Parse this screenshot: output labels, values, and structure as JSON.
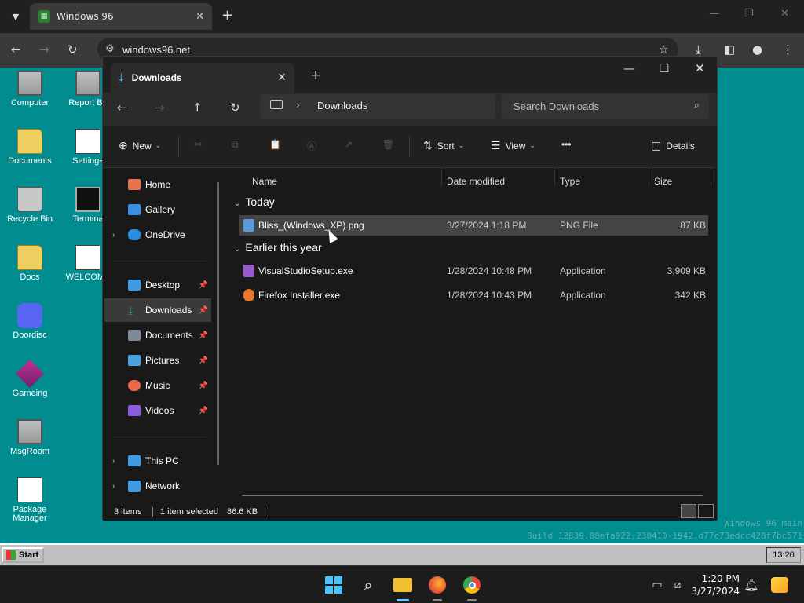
{
  "browser": {
    "tab_title": "Windows 96",
    "url": "windows96.net",
    "favicon": "windows96-favicon"
  },
  "desktop": {
    "icons": [
      {
        "label": "Computer",
        "icon": "computer-icon"
      },
      {
        "label": "Report Bu",
        "icon": "report-icon"
      },
      {
        "label": "Documents",
        "icon": "folder-icon"
      },
      {
        "label": "Settings",
        "icon": "settings-icon"
      },
      {
        "label": "Recycle Bin",
        "icon": "recycle-bin-icon"
      },
      {
        "label": "Termina",
        "icon": "terminal-icon"
      },
      {
        "label": "Docs",
        "icon": "folder-icon"
      },
      {
        "label": "WELCOME",
        "icon": "markdown-file-icon"
      },
      {
        "label": "Doordisc",
        "icon": "discord-icon"
      },
      {
        "label": "Gameing",
        "icon": "cube-icon"
      },
      {
        "label": "MsgRoom",
        "icon": "msgroom-icon"
      },
      {
        "label": "Package Manager",
        "icon": "package-icon"
      }
    ],
    "watermark_line1": "Windows 96 main",
    "watermark_line2": "Build 12839.88efa922.230410-1942.d77c73edcc428f7bc571",
    "taskbar": {
      "start_label": "Start",
      "clock": "13:20"
    }
  },
  "explorer": {
    "tab_title": "Downloads",
    "address_path": "Downloads",
    "search_placeholder": "Search Downloads",
    "commands": {
      "new": "New",
      "sort": "Sort",
      "view": "View",
      "more": "•••",
      "details": "Details"
    },
    "sidebar": [
      {
        "label": "Home",
        "icon": "home-icon",
        "color": "#e8704a"
      },
      {
        "label": "Gallery",
        "icon": "gallery-icon",
        "color": "#3a8ee6"
      },
      {
        "label": "OneDrive",
        "icon": "onedrive-icon",
        "color": "#2a8be0"
      },
      {
        "label": "Desktop",
        "icon": "desktop-icon",
        "color": "#3a9be6"
      },
      {
        "label": "Downloads",
        "icon": "download-icon",
        "color": "#2eb15c"
      },
      {
        "label": "Documents",
        "icon": "documents-icon",
        "color": "#7e8a99"
      },
      {
        "label": "Pictures",
        "icon": "pictures-icon",
        "color": "#4aa3e0"
      },
      {
        "label": "Music",
        "icon": "music-icon",
        "color": "#e86a4a"
      },
      {
        "label": "Videos",
        "icon": "videos-icon",
        "color": "#8a5ae0"
      },
      {
        "label": "This PC",
        "icon": "this-pc-icon",
        "color": "#3a9be6"
      },
      {
        "label": "Network",
        "icon": "network-icon",
        "color": "#3a9be6"
      }
    ],
    "columns": {
      "name": "Name",
      "date": "Date modified",
      "type": "Type",
      "size": "Size"
    },
    "groups": [
      {
        "label": "Today",
        "files": [
          {
            "name": "Bliss_(Windows_XP).png",
            "date": "3/27/2024 1:18 PM",
            "type": "PNG File",
            "size": "87 KB",
            "icon": "image-file-icon",
            "color": "#5a9ad8"
          }
        ]
      },
      {
        "label": "Earlier this year",
        "files": [
          {
            "name": "VisualStudioSetup.exe",
            "date": "1/28/2024 10:48 PM",
            "type": "Application",
            "size": "3,909 KB",
            "icon": "visual-studio-icon",
            "color": "#9b59d0"
          },
          {
            "name": "Firefox Installer.exe",
            "date": "1/28/2024 10:43 PM",
            "type": "Application",
            "size": "342 KB",
            "icon": "firefox-icon",
            "color": "#e8772a"
          }
        ]
      }
    ],
    "status": {
      "count": "3 items",
      "selected": "1 item selected",
      "size": "86.6 KB"
    }
  },
  "system": {
    "time": "1:20 PM",
    "date": "3/27/2024"
  }
}
